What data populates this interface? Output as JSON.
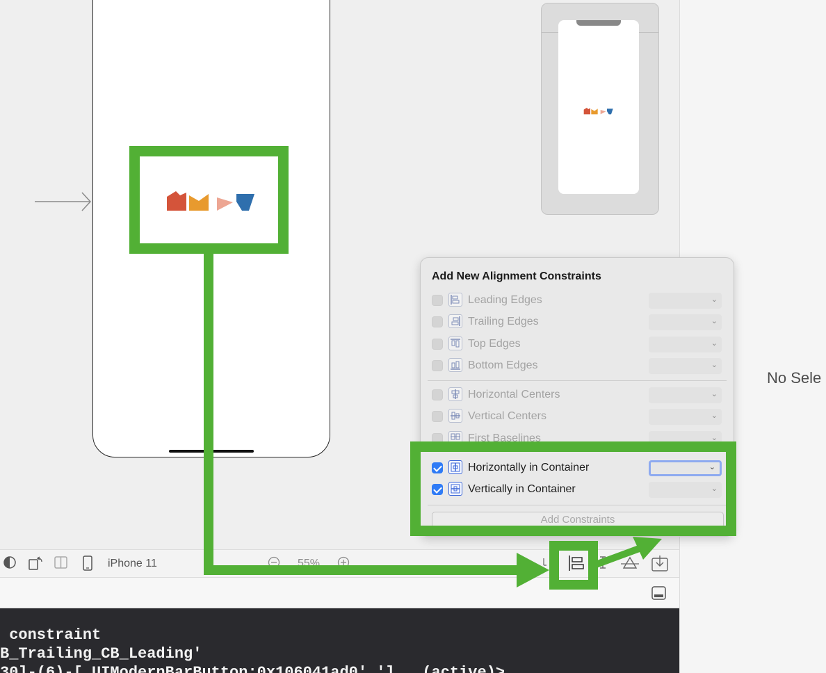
{
  "canvas": {
    "sidebar": {
      "no_selection": "No Sele"
    },
    "toolbar": {
      "device": "iPhone 11",
      "zoom": "55%"
    }
  },
  "popover": {
    "title": "Add New Alignment Constraints",
    "rows": [
      {
        "label": "Leading Edges",
        "checked": false
      },
      {
        "label": "Trailing Edges",
        "checked": false
      },
      {
        "label": "Top Edges",
        "checked": false
      },
      {
        "label": "Bottom Edges",
        "checked": false
      },
      {
        "label": "Horizontal Centers",
        "checked": false
      },
      {
        "label": "Vertical Centers",
        "checked": false
      },
      {
        "label": "First Baselines",
        "checked": false
      },
      {
        "label": "Horizontally in Container",
        "checked": true
      },
      {
        "label": "Vertically in Container",
        "checked": true
      }
    ],
    "add_button": "Add Constraints"
  },
  "console": {
    "lines": [
      " constraint",
      "B_Trailing_CB_Leading'",
      "30]-(6)-[_UIModernBarButton:0x106041ad0' ']   (active)>"
    ]
  },
  "colors": {
    "highlight": "#52b035",
    "logo": [
      "#d4543a",
      "#e89a2e",
      "#eda693",
      "#2f6fad"
    ],
    "accent": "#2f7bf6"
  }
}
